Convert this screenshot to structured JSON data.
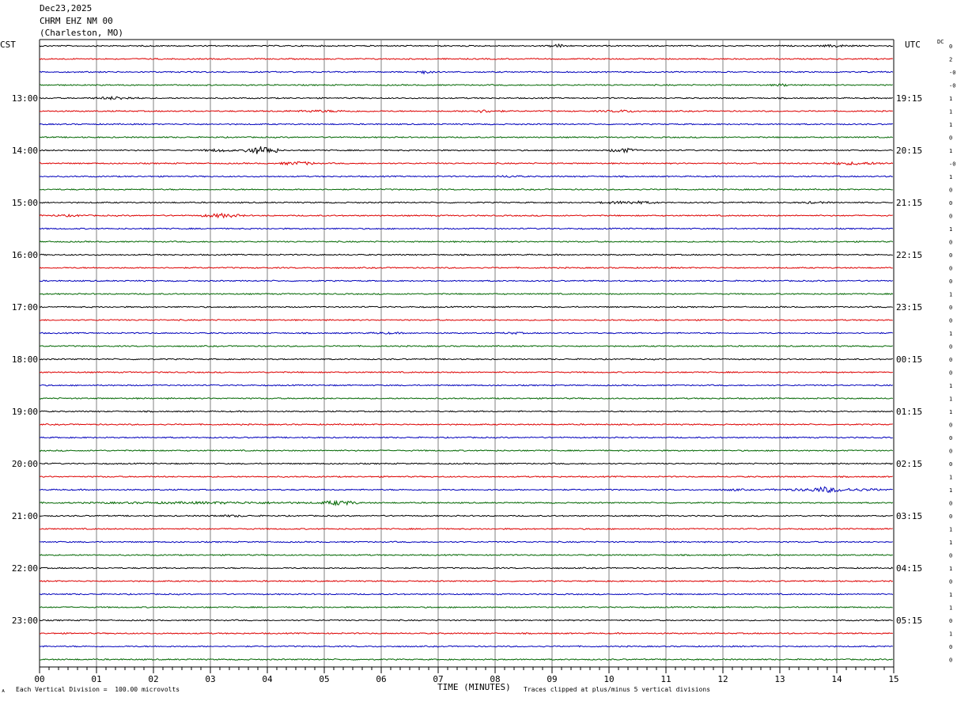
{
  "header": {
    "date": "Dec23,2025",
    "station": "CHRM EHZ NM 00",
    "location": "(Charleston, MO)"
  },
  "labels": {
    "left_timezone": "CST",
    "right_timezone": "UTC",
    "dc_header": "DC",
    "x_axis_title": "TIME (MINUTES)",
    "scale_note": "Each Vertical Division =  100.00 microvolts",
    "clip_note": "Traces clipped at plus/minus 5 vertical divisions",
    "corner_mark": "ᴀ"
  },
  "colors": {
    "trace_cycle": [
      "#000000",
      "#dd0000",
      "#0000bb",
      "#006600"
    ],
    "grid": "#808080",
    "minor_tick": "#6666aa"
  },
  "chart_data": {
    "type": "line",
    "title": "CHRM EHZ NM 00",
    "xlabel": "TIME (MINUTES)",
    "ylabel": "",
    "xlim": [
      0,
      15
    ],
    "x_ticks": [
      "00",
      "01",
      "02",
      "03",
      "04",
      "05",
      "06",
      "07",
      "08",
      "09",
      "10",
      "11",
      "12",
      "13",
      "14",
      "15"
    ],
    "grid": true,
    "rows_per_hour": 4,
    "row_count": 48,
    "left_hour_labels": [
      "13:00",
      "14:00",
      "15:00",
      "16:00",
      "17:00",
      "18:00",
      "19:00",
      "20:00",
      "21:00",
      "22:00",
      "23:00"
    ],
    "right_hour_labels": [
      "19:15",
      "20:15",
      "21:15",
      "22:15",
      "23:15",
      "00:15",
      "01:15",
      "02:15",
      "03:15",
      "04:15",
      "05:15"
    ],
    "dc_offsets": [
      "0",
      "2",
      "-0",
      "-0",
      "1",
      "1",
      "1",
      "0",
      "1",
      "-0",
      "1",
      "0",
      "0",
      "0",
      "1",
      "0",
      "0",
      "0",
      "0",
      "1",
      "0",
      "0",
      "1",
      "0",
      "0",
      "0",
      "1",
      "1",
      "1",
      "0",
      "0",
      "0",
      "0",
      "1",
      "1",
      "0",
      "0",
      "1",
      "1",
      "0",
      "1",
      "0",
      "1",
      "1",
      "0",
      "1",
      "0",
      "0"
    ],
    "events": [
      {
        "row": 0,
        "start_min": 8.9,
        "end_min": 9.3,
        "amplitude": 2.5
      },
      {
        "row": 0,
        "start_min": 13.7,
        "end_min": 14.3,
        "amplitude": 2.0
      },
      {
        "row": 2,
        "start_min": 6.6,
        "end_min": 6.9,
        "amplitude": 2.5
      },
      {
        "row": 3,
        "start_min": 12.8,
        "end_min": 13.3,
        "amplitude": 1.8
      },
      {
        "row": 4,
        "start_min": 0.9,
        "end_min": 1.8,
        "amplitude": 2.2
      },
      {
        "row": 5,
        "start_min": 3.9,
        "end_min": 6.0,
        "amplitude": 1.5
      },
      {
        "row": 5,
        "start_min": 7.4,
        "end_min": 8.2,
        "amplitude": 2.0
      },
      {
        "row": 5,
        "start_min": 9.7,
        "end_min": 10.8,
        "amplitude": 1.6
      },
      {
        "row": 8,
        "start_min": 2.8,
        "end_min": 3.5,
        "amplitude": 2.0
      },
      {
        "row": 8,
        "start_min": 3.6,
        "end_min": 4.2,
        "amplitude": 5.5
      },
      {
        "row": 8,
        "start_min": 10.0,
        "end_min": 10.5,
        "amplitude": 3.0
      },
      {
        "row": 9,
        "start_min": 4.2,
        "end_min": 4.9,
        "amplitude": 2.5
      },
      {
        "row": 9,
        "start_min": 13.6,
        "end_min": 15.0,
        "amplitude": 2.0
      },
      {
        "row": 10,
        "start_min": 7.9,
        "end_min": 8.6,
        "amplitude": 1.5
      },
      {
        "row": 12,
        "start_min": 9.8,
        "end_min": 10.9,
        "amplitude": 2.2
      },
      {
        "row": 12,
        "start_min": 13.2,
        "end_min": 14.0,
        "amplitude": 1.5
      },
      {
        "row": 13,
        "start_min": 0.0,
        "end_min": 1.0,
        "amplitude": 1.5
      },
      {
        "row": 13,
        "start_min": 2.8,
        "end_min": 3.6,
        "amplitude": 2.8
      },
      {
        "row": 22,
        "start_min": 5.6,
        "end_min": 6.6,
        "amplitude": 1.4
      },
      {
        "row": 22,
        "start_min": 8.0,
        "end_min": 8.6,
        "amplitude": 1.5
      },
      {
        "row": 34,
        "start_min": 11.9,
        "end_min": 12.5,
        "amplitude": 1.5
      },
      {
        "row": 34,
        "start_min": 12.8,
        "end_min": 15.0,
        "amplitude": 2.2
      },
      {
        "row": 34,
        "start_min": 13.5,
        "end_min": 14.1,
        "amplitude": 4.0
      },
      {
        "row": 35,
        "start_min": 0.0,
        "end_min": 6.0,
        "amplitude": 1.6
      },
      {
        "row": 35,
        "start_min": 4.9,
        "end_min": 5.6,
        "amplitude": 3.2
      },
      {
        "row": 36,
        "start_min": 2.8,
        "end_min": 4.0,
        "amplitude": 1.4
      }
    ]
  }
}
